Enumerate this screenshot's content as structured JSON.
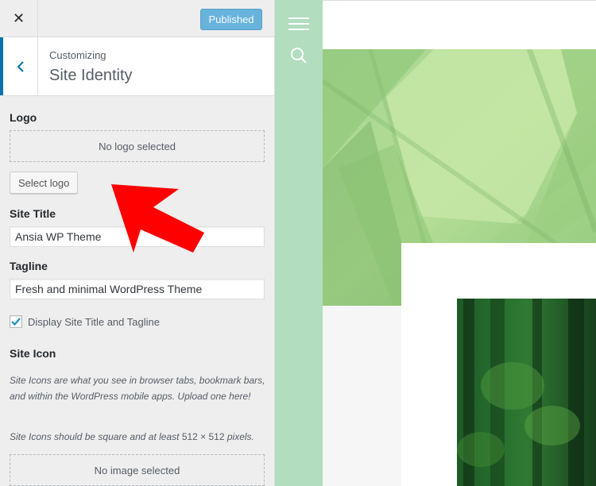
{
  "topbar": {
    "close_icon": "close-icon",
    "publish_label": "Published"
  },
  "section": {
    "back_icon": "chevron-left-icon",
    "subtitle": "Customizing",
    "title": "Site Identity"
  },
  "logo": {
    "label": "Logo",
    "placeholder": "No logo selected",
    "button_label": "Select logo"
  },
  "site_title": {
    "label": "Site Title",
    "value": "Ansia WP Theme"
  },
  "tagline": {
    "label": "Tagline",
    "value": "Fresh and minimal WordPress Theme"
  },
  "display_title": {
    "label": "Display Site Title and Tagline",
    "checked": true
  },
  "site_icon": {
    "label": "Site Icon",
    "description_1": "Site Icons are what you see in browser tabs, bookmark bars, and within the WordPress mobile apps. Upload one here!",
    "description_2_prefix": "Site Icons should be square and at least ",
    "description_2_size": "512 × 512",
    "description_2_suffix": " pixels.",
    "placeholder": "No image selected"
  },
  "theme_nav": {
    "menu_icon": "hamburger-menu-icon",
    "search_icon": "search-icon"
  },
  "colors": {
    "accent": "#0073aa",
    "publish_button": "#3ba0d6",
    "nav_strip": "#b2ddbf",
    "annotation_arrow": "#ff0000"
  }
}
